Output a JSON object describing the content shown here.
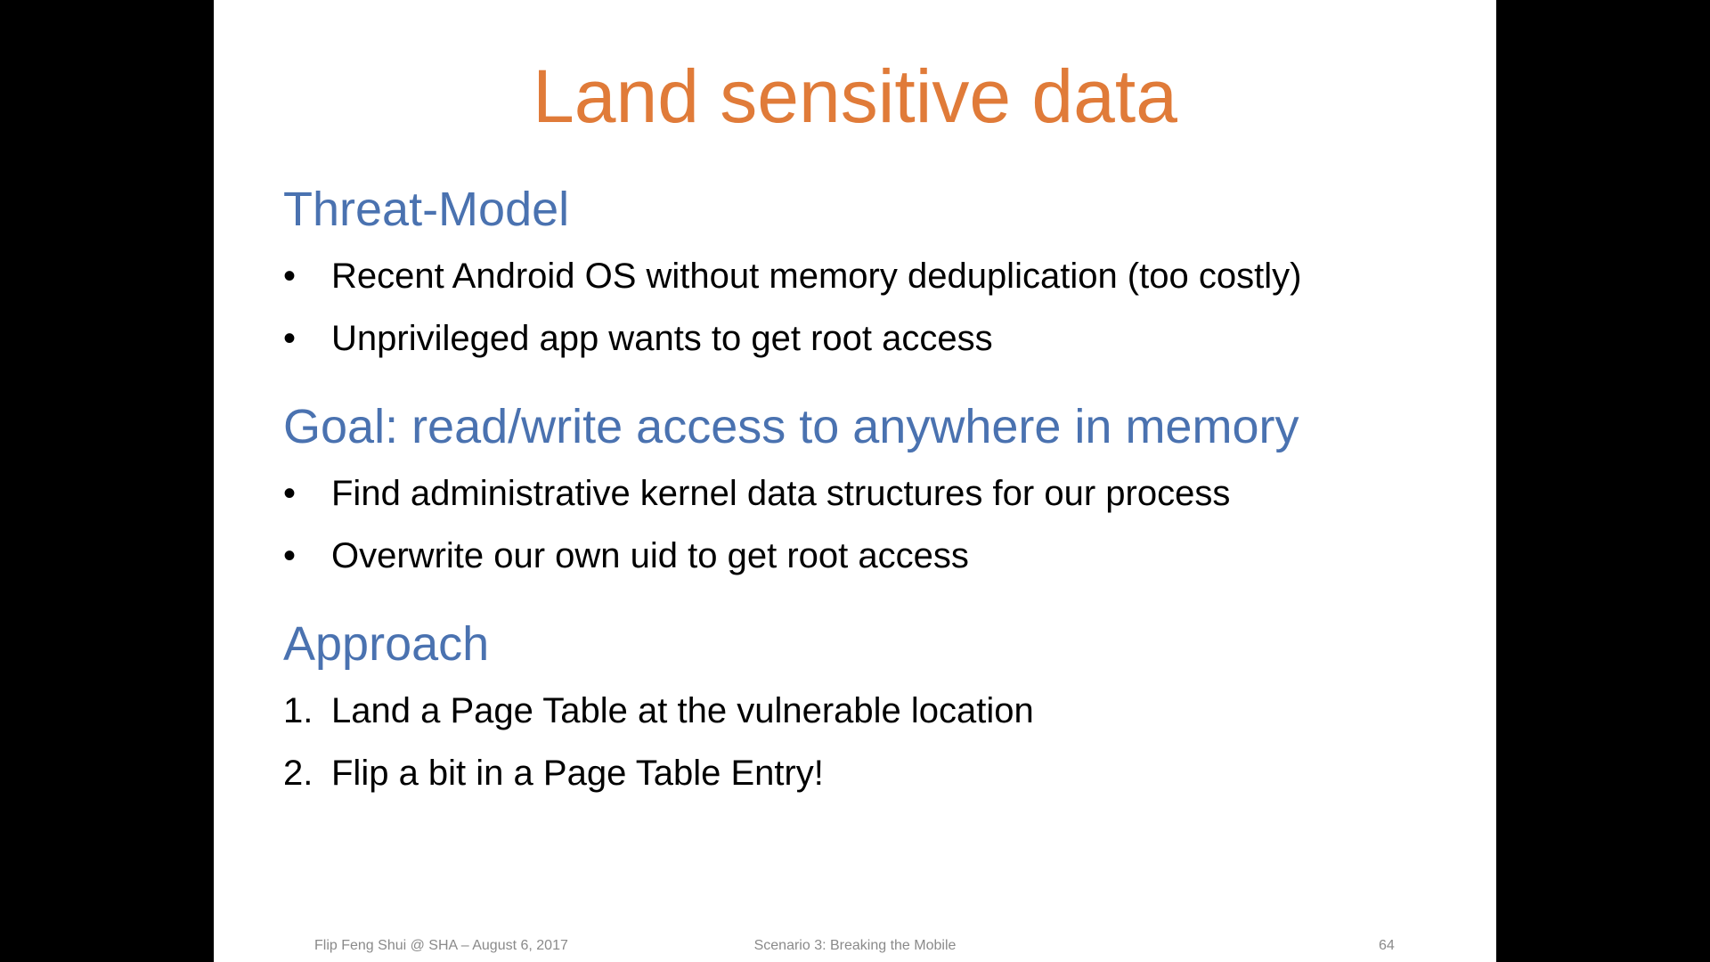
{
  "slide": {
    "title": "Land sensitive data",
    "sections": [
      {
        "heading": "Threat-Model",
        "items": [
          {
            "marker": "•",
            "text": "Recent Android OS without memory deduplication (too costly)"
          },
          {
            "marker": "•",
            "text": "Unprivileged app wants to get root access"
          }
        ]
      },
      {
        "heading": "Goal: read/write access to anywhere in memory",
        "items": [
          {
            "marker": "•",
            "text": "Find administrative kernel data structures for our process"
          },
          {
            "marker": "•",
            "text": "Overwrite our own uid to get root access"
          }
        ]
      },
      {
        "heading": "Approach",
        "items": [
          {
            "marker": "1.",
            "text": "Land a Page Table at the vulnerable location"
          },
          {
            "marker": "2.",
            "text": "Flip a bit in a Page Table Entry!"
          }
        ]
      }
    ],
    "footer": {
      "left": "Flip Feng Shui @ SHA – August 6, 2017",
      "center": "Scenario 3: Breaking the Mobile",
      "page_number": "64"
    }
  },
  "colors": {
    "title": "#E07B39",
    "heading": "#4A72B0",
    "body_text": "#000000",
    "footer_text": "#8a8a8a",
    "slide_background": "#ffffff",
    "letterbox": "#000000"
  }
}
